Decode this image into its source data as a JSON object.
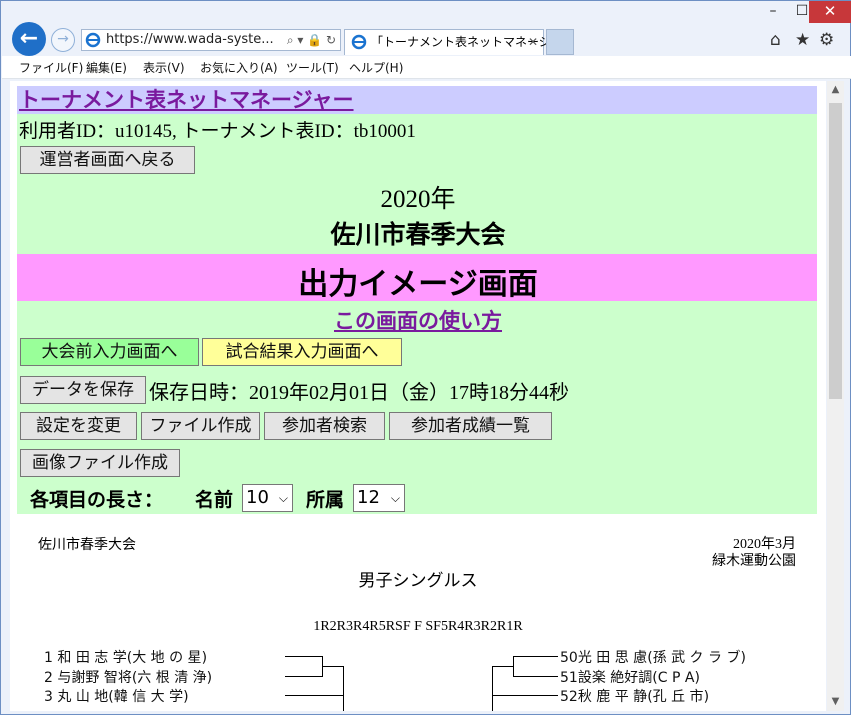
{
  "browser": {
    "window_controls": {
      "minimize": "–",
      "maximize": "☐",
      "close": "✕"
    },
    "url": "https://www.wada-syste...",
    "tab_title": "「トーナメント表ネットマネージャ...",
    "tab_close": "✕",
    "menu": [
      "ファイル(F)",
      "編集(E)",
      "表示(V)",
      "お気に入り(A)",
      "ツール(T)",
      "ヘルプ(H)"
    ],
    "icons": {
      "back": "back-arrow-icon",
      "forward": "forward-arrow-icon",
      "home": "home-icon",
      "favorites": "star-icon",
      "settings": "gear-icon"
    }
  },
  "page": {
    "app_title": "トーナメント表ネットマネージャー",
    "user_info": "利用者ID：u10145, トーナメント表ID：tb10001",
    "back_to_admin": "運営者画面へ戻る",
    "year": "2020年",
    "event_name": "佐川市春季大会",
    "screen_title": "出力イメージ画面",
    "howto_link": "この画面の使い方",
    "btn_pre_input": "大会前入力画面へ",
    "btn_result_input": "試合結果入力画面へ",
    "btn_save": "データを保存",
    "save_time_label": "保存日時：2019年02月01日（金）17時18分44秒",
    "btn_settings": "設定を変更",
    "btn_make_file": "ファイル作成",
    "btn_search": "参加者検索",
    "btn_results_list": "参加者成績一覧",
    "btn_make_image": "画像ファイル作成",
    "length_label": "各項目の長さ：",
    "name_label": "名前",
    "name_value": "10",
    "affil_label": "所属",
    "affil_value": "12"
  },
  "preview": {
    "event": "佐川市春季大会",
    "date": "2020年3月",
    "venue": "緑木運動公園",
    "category": "男子シングルス",
    "rounds": "1R2R3R4R5RSF F SF5R4R3R2R1R",
    "left": [
      {
        "no": "1",
        "name": "和 田  志 学",
        "affil": "大 地 の 星"
      },
      {
        "no": "2",
        "name": "与謝野 智将",
        "affil": "六 根 清 浄"
      },
      {
        "no": "3",
        "name": "丸 山    地",
        "affil": "韓 信 大 学"
      }
    ],
    "right": [
      {
        "no": "50",
        "name": "光 田  思 慮",
        "affil": "孫 武 ク ラ ブ"
      },
      {
        "no": "51",
        "name": "設楽 絶好調",
        "affil": "C  P  A"
      },
      {
        "no": "52",
        "name": "秋 鹿  平 静",
        "affil": "孔  丘  市"
      }
    ]
  }
}
